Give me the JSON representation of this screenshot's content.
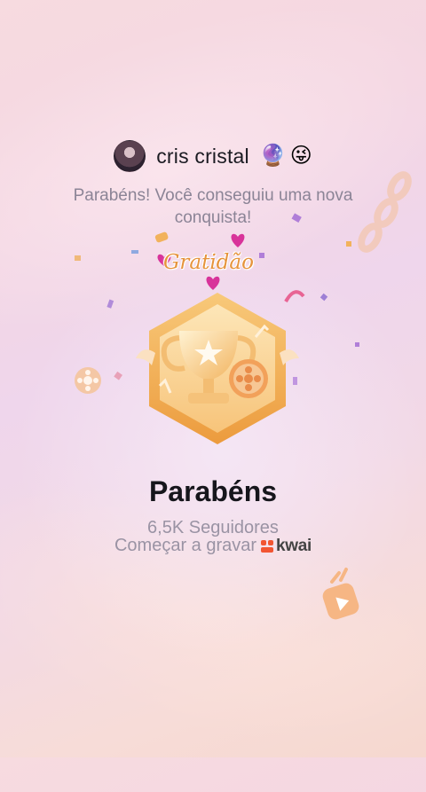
{
  "profile": {
    "username": "cris cristal",
    "emojis": [
      "🔮",
      "😜"
    ]
  },
  "message": "Parabéns! Você conseguiu uma nova conquista!",
  "badge": {
    "label": "Gratidão"
  },
  "achievement": {
    "title": "Parabéns",
    "followers": "6,5K Seguidores",
    "record": "Começar a gravar",
    "brand": "kwai"
  },
  "colors": {
    "badge_orange": "#f0a94a",
    "badge_light": "#fde2b3",
    "heart_pink": "#d8339a",
    "brand_red": "#f25532"
  }
}
